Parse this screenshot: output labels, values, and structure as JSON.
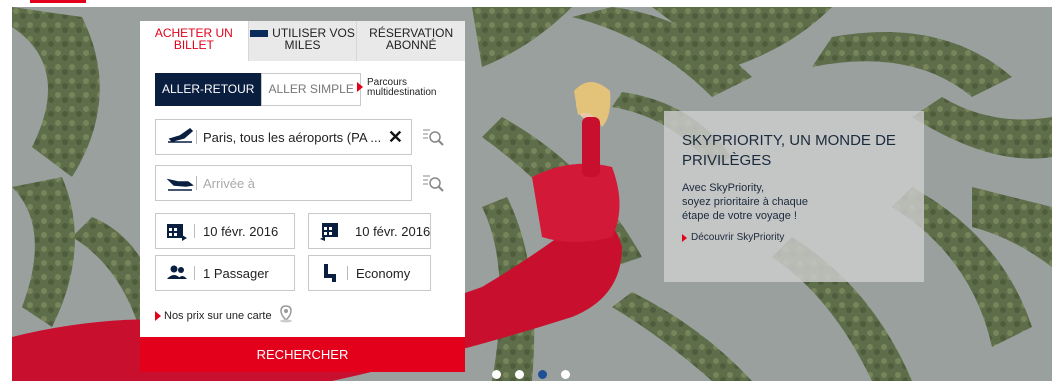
{
  "booking": {
    "tabs": [
      {
        "label": "ACHETER UN BILLET"
      },
      {
        "label": "UTILISER VOS MILES"
      },
      {
        "label": "RÉSERVATION ABONNÉ"
      }
    ],
    "trip_types": [
      {
        "label": "ALLER-RETOUR"
      },
      {
        "label": "ALLER SIMPLE"
      }
    ],
    "multi_link": {
      "line1": "Parcours",
      "line2": "multidestination"
    },
    "departure": {
      "value": "Paris, tous les aéroports (PA ..."
    },
    "arrival": {
      "placeholder": "Arrivée à"
    },
    "date_out": "10 févr. 2016",
    "date_return": "10 févr. 2016",
    "passengers": "1 Passager",
    "cabin": "Economy",
    "map_link": "Nos prix sur une carte",
    "search_label": "RECHERCHER"
  },
  "promo": {
    "title": "SKYPRIORITY, UN MONDE DE PRIVILÈGES",
    "desc_lines": [
      "Avec SkyPriority,",
      "soyez prioritaire à chaque",
      "étape de votre voyage !"
    ],
    "link": "Découvrir SkyPriority"
  },
  "carousel": {
    "count": 4,
    "active_index": 2
  },
  "colors": {
    "accent": "#e2001a",
    "navy": "#0a1e40",
    "dot_active": "#1f4f95"
  }
}
